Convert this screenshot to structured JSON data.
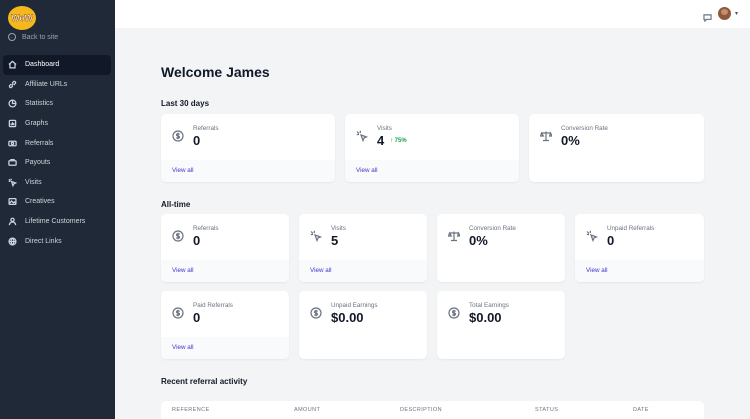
{
  "sidebar": {
    "logo_text": "WoW",
    "back_label": "Back to site",
    "items": [
      {
        "label": "Dashboard",
        "icon": "home-icon",
        "active": true
      },
      {
        "label": "Affiliate URLs",
        "icon": "link-icon"
      },
      {
        "label": "Statistics",
        "icon": "pie-chart-icon"
      },
      {
        "label": "Graphs",
        "icon": "bar-chart-icon"
      },
      {
        "label": "Referrals",
        "icon": "money-icon"
      },
      {
        "label": "Payouts",
        "icon": "payouts-icon"
      },
      {
        "label": "Visits",
        "icon": "cursor-click-icon"
      },
      {
        "label": "Creatives",
        "icon": "image-icon"
      },
      {
        "label": "Lifetime Customers",
        "icon": "users-icon"
      },
      {
        "label": "Direct Links",
        "icon": "globe-icon"
      }
    ]
  },
  "header": {
    "caret": "▾"
  },
  "main": {
    "welcome": "Welcome James",
    "last30": {
      "heading": "Last 30 days",
      "cards": [
        {
          "label": "Referrals",
          "value": "0",
          "link": "View all",
          "icon": "dollar-circle-icon"
        },
        {
          "label": "Visits",
          "value": "4",
          "delta": "75%",
          "link": "View all",
          "icon": "cursor-click-icon"
        },
        {
          "label": "Conversion Rate",
          "value": "0%",
          "icon": "scale-icon"
        }
      ]
    },
    "alltime": {
      "heading": "All-time",
      "cards": [
        {
          "label": "Referrals",
          "value": "0",
          "link": "View all",
          "icon": "dollar-circle-icon"
        },
        {
          "label": "Visits",
          "value": "5",
          "link": "View all",
          "icon": "cursor-click-icon"
        },
        {
          "label": "Conversion Rate",
          "value": "0%",
          "icon": "scale-icon"
        },
        {
          "label": "Unpaid Referrals",
          "value": "0",
          "link": "View all",
          "icon": "cursor-click-icon"
        },
        {
          "label": "Paid Referrals",
          "value": "0",
          "link": "View all",
          "icon": "dollar-circle-icon"
        },
        {
          "label": "Unpaid Earnings",
          "value": "$0.00",
          "icon": "dollar-circle-icon"
        },
        {
          "label": "Total Earnings",
          "value": "$0.00",
          "icon": "dollar-circle-icon"
        }
      ]
    },
    "recent": {
      "heading": "Recent referral activity",
      "columns": [
        "REFERENCE",
        "AMOUNT",
        "DESCRIPTION",
        "STATUS",
        "DATE"
      ]
    }
  }
}
